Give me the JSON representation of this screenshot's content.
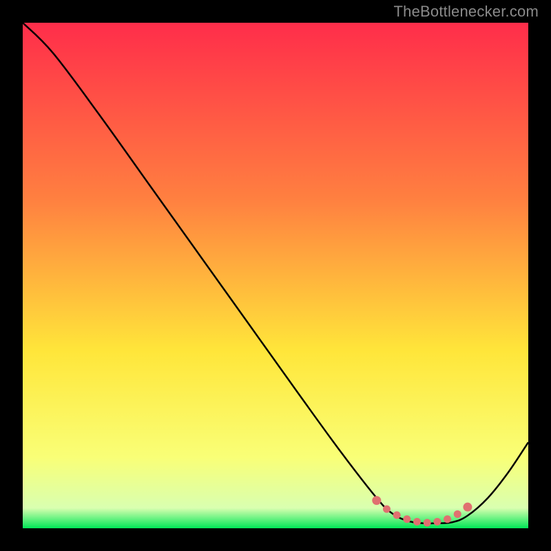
{
  "watermark": "TheBottlenecker.com",
  "colors": {
    "top_red": "#ff2d4a",
    "mid_orange": "#ff8040",
    "yellow": "#ffe63a",
    "pale_yellow": "#f9ff77",
    "green": "#00e656",
    "curve_stroke": "#000000",
    "curve_fill": "#ffffff",
    "dot_fill": "#e07070",
    "dot_stroke": "#e07070"
  },
  "chart_data": {
    "type": "line",
    "title": "",
    "xlabel": "",
    "ylabel": "",
    "xlim": [
      0,
      100
    ],
    "ylim": [
      0,
      100
    ],
    "series": [
      {
        "name": "bottleneck-curve",
        "x": [
          0,
          6,
          15,
          25,
          35,
          45,
          55,
          63,
          70,
          73,
          76,
          79,
          82,
          85,
          88,
          92,
          96,
          100
        ],
        "y": [
          100,
          94,
          82,
          68,
          54,
          40,
          26,
          15,
          6,
          3,
          1.5,
          1,
          1,
          1.2,
          2.5,
          6,
          11,
          17
        ]
      }
    ],
    "sweet_spot_dots": {
      "name": "optimal-range-markers",
      "x": [
        70,
        72,
        74,
        76,
        78,
        80,
        82,
        84,
        86,
        88
      ],
      "y": [
        5.5,
        3.8,
        2.6,
        1.8,
        1.3,
        1.1,
        1.3,
        1.8,
        2.8,
        4.2
      ]
    }
  }
}
